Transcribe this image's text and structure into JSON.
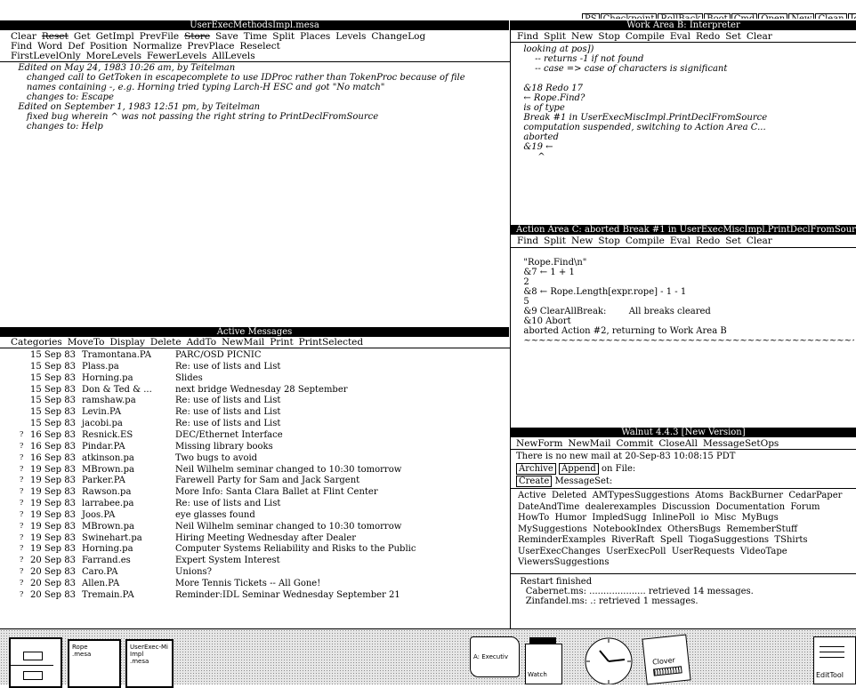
{
  "top_buttons": [
    {
      "label": "PS",
      "strike": false
    },
    {
      "label": "Checkpoint",
      "strike": true
    },
    {
      "label": "RollBack",
      "strike": true
    },
    {
      "label": "Boot",
      "strike": false
    },
    {
      "label": "Cmd",
      "strike": false
    },
    {
      "label": "Open",
      "strike": false
    },
    {
      "label": "New",
      "strike": false
    },
    {
      "label": "Clean",
      "strike": false
    },
    {
      "label": "Id",
      "strike": false
    }
  ],
  "editor": {
    "title": "UserExecMethodsImpl.mesa",
    "menu_row1": [
      {
        "label": "Clear",
        "strike": false
      },
      {
        "label": "Reset",
        "strike": true
      },
      {
        "label": "Get",
        "strike": false
      },
      {
        "label": "GetImpl",
        "strike": false
      },
      {
        "label": "PrevFile",
        "strike": false
      },
      {
        "label": "Store",
        "strike": true
      },
      {
        "label": "Save",
        "strike": false
      },
      {
        "label": "Time",
        "strike": false
      },
      {
        "label": "Split",
        "strike": false
      },
      {
        "label": "Places",
        "strike": false
      },
      {
        "label": "Levels",
        "strike": false
      },
      {
        "label": "ChangeLog",
        "strike": false
      }
    ],
    "menu_row2": [
      "Find",
      "Word",
      "Def",
      "Position",
      "Normalize",
      "PrevPlace",
      "Reselect"
    ],
    "menu_row3": [
      "FirstLevelOnly",
      "MoreLevels",
      "FewerLevels",
      "AllLevels"
    ],
    "content": [
      "  Edited on May 24, 1983 10:26 am, by Teitelman",
      "     changed call to GetToken in escapecomplete to use IDProc rather than TokenProc because of file",
      "     names containing -, e.g. Horning tried typing Larch-H ESC and got \"No match\"",
      "     changes to: Escape",
      "  Edited on September 1, 1983 12:51 pm, by Teitelman",
      "     fixed bug wherein ^ was not passing the right string to PrintDeclFromSource",
      "     changes to: Help"
    ]
  },
  "messages": {
    "title": "Active Messages",
    "menu": [
      "Categories",
      "MoveTo",
      "Display",
      "Delete",
      "AddTo",
      "NewMail",
      "Print",
      "PrintSelected"
    ],
    "rows": [
      {
        "mark": "",
        "date": "15 Sep 83",
        "from": "Tramontana.PA",
        "subject": "PARC/OSD PICNIC"
      },
      {
        "mark": "",
        "date": "15 Sep 83",
        "from": "Plass.pa",
        "subject": "Re: use of lists and List"
      },
      {
        "mark": "",
        "date": "15 Sep 83",
        "from": "Horning.pa",
        "subject": "Slides"
      },
      {
        "mark": "",
        "date": "15 Sep 83",
        "from": "Don & Ted & ...",
        "subject": "next bridge Wednesday 28 September"
      },
      {
        "mark": "",
        "date": "15 Sep 83",
        "from": "ramshaw.pa",
        "subject": "Re: use of lists and List"
      },
      {
        "mark": "",
        "date": "15 Sep 83",
        "from": "Levin.PA",
        "subject": "Re: use of lists and List"
      },
      {
        "mark": "",
        "date": "15 Sep 83",
        "from": "jacobi.pa",
        "subject": "Re: use of lists and List"
      },
      {
        "mark": "?",
        "date": "16 Sep 83",
        "from": "Resnick.ES",
        "subject": "DEC/Ethernet Interface"
      },
      {
        "mark": "?",
        "date": "16 Sep 83",
        "from": "Pindar.PA",
        "subject": "Missing library books"
      },
      {
        "mark": "?",
        "date": "16 Sep 83",
        "from": "atkinson.pa",
        "subject": "Two bugs to avoid"
      },
      {
        "mark": "?",
        "date": "19 Sep 83",
        "from": "MBrown.pa",
        "subject": "Neil Wilhelm seminar changed to 10:30 tomorrow"
      },
      {
        "mark": "?",
        "date": "19 Sep 83",
        "from": "Parker.PA",
        "subject": "Farewell Party for Sam and Jack Sargent"
      },
      {
        "mark": "?",
        "date": "19 Sep 83",
        "from": "Rawson.pa",
        "subject": "More Info: Santa Clara Ballet at Flint Center"
      },
      {
        "mark": "?",
        "date": "19 Sep 83",
        "from": "larrabee.pa",
        "subject": "Re: use of lists and List"
      },
      {
        "mark": "?",
        "date": "19 Sep 83",
        "from": "Joos.PA",
        "subject": "eye glasses found"
      },
      {
        "mark": "?",
        "date": "19 Sep 83",
        "from": "MBrown.pa",
        "subject": "Neil Wilhelm seminar changed to 10:30 tomorrow"
      },
      {
        "mark": "?",
        "date": "19 Sep 83",
        "from": "Swinehart.pa",
        "subject": "Hiring Meeting Wednesday after Dealer"
      },
      {
        "mark": "?",
        "date": "19 Sep 83",
        "from": "Horning.pa",
        "subject": "Computer Systems Reliability and Risks to the Public"
      },
      {
        "mark": "?",
        "date": "20 Sep 83",
        "from": "Farrand.es",
        "subject": "Expert System Interest"
      },
      {
        "mark": "?",
        "date": "20 Sep 83",
        "from": "Caro.PA",
        "subject": "Unions?"
      },
      {
        "mark": "?",
        "date": "20 Sep 83",
        "from": "Allen.PA",
        "subject": "More Tennis Tickets -- All Gone!"
      },
      {
        "mark": "?",
        "date": "20 Sep 83",
        "from": "Tremain.PA",
        "subject": "Reminder:IDL Seminar Wednesday September 21"
      }
    ]
  },
  "work_area_b": {
    "title": "Work Area B: Interpreter",
    "menu": [
      "Find",
      "Split",
      "New",
      "Stop",
      "Compile",
      "Eval",
      "Redo",
      "Set",
      "Clear"
    ],
    "content": [
      "  looking at pos])",
      "      -- returns -1 if not found",
      "      -- case => case of characters is significant",
      "",
      "  &18 Redo 17",
      "  ← Rope.Find?",
      "  is of type",
      "  Break #1 in UserExecMiscImpl.PrintDeclFromSource",
      "  computation suspended, switching to Action Area C...",
      "  aborted",
      "  &19 ←",
      "       ^"
    ]
  },
  "action_area_c": {
    "title": "Action Area C: aborted Break #1 in UserExecMiscImpl.PrintDeclFromSource",
    "menu": [
      "Find",
      "Split",
      "New",
      "Stop",
      "Compile",
      "Eval",
      "Redo",
      "Set",
      "Clear"
    ],
    "content": [
      "  \"Rope.Find\\n\"",
      "  &7 ← 1 + 1",
      "  2",
      "  &8 ← Rope.Length[expr.rope] - 1 - 1",
      "  5",
      "  &9 ClearAllBreak:        All breaks cleared",
      "  &10 Abort",
      "  aborted Action #2, returning to Work Area B",
      "  ~~~~~~~~~~~~~~~~~~~~~~~~~~~~~~~~~~~~~~~~~~~~~~~~~~~~~~~"
    ]
  },
  "walnut": {
    "title": "Walnut 4.4.3  [New Version]",
    "menu": [
      "NewForm",
      "NewMail",
      "Commit",
      "CloseAll",
      "MessageSetOps"
    ],
    "status": "There is no new mail at 20-Sep-83 10:08:15 PDT",
    "archive_label": "Archive",
    "append_label": "Append",
    "on_file_label": "on File:",
    "create_label": "Create",
    "messageset_label": "MessageSet:",
    "message_sets": "Active  Deleted  AMTypesSuggestions  Atoms  BackBurner  CedarPaper\nDateAndTime  dealerexamples  Discussion  Documentation  Forum\nHowTo  Humor  ImpledSugg  InlinePoll  io  Misc  MyBugs\nMySuggestions  NotebookIndex  OthersBugs  RememberStuff\nReminderExamples  RiverRaft  Spell  TiogaSuggestions  TShirts\nUserExecChanges  UserExecPoll  UserRequests  VideoTape\nViewersSuggestions",
    "log": "  Restart finished\n    Cabernet.ms: .................... retrieved 14 messages.\n    Zinfandel.ms: .: retrieved 1 messages."
  },
  "icons": [
    {
      "label": "",
      "name": "file-cabinet-icon"
    },
    {
      "label": "Rope\n.mesa",
      "name": "document-icon-rope"
    },
    {
      "label": "UserExec-Mi\nImpl\n.mesa",
      "name": "document-icon-userexec"
    },
    {
      "label": "A: Executiv",
      "name": "scroll-icon-executive"
    },
    {
      "label": "Watch",
      "name": "watch-icon"
    },
    {
      "label": "",
      "name": "clock-icon"
    },
    {
      "label": "Clover",
      "name": "clover-icon"
    },
    {
      "label": "EditTool",
      "name": "edittool-icon"
    }
  ]
}
